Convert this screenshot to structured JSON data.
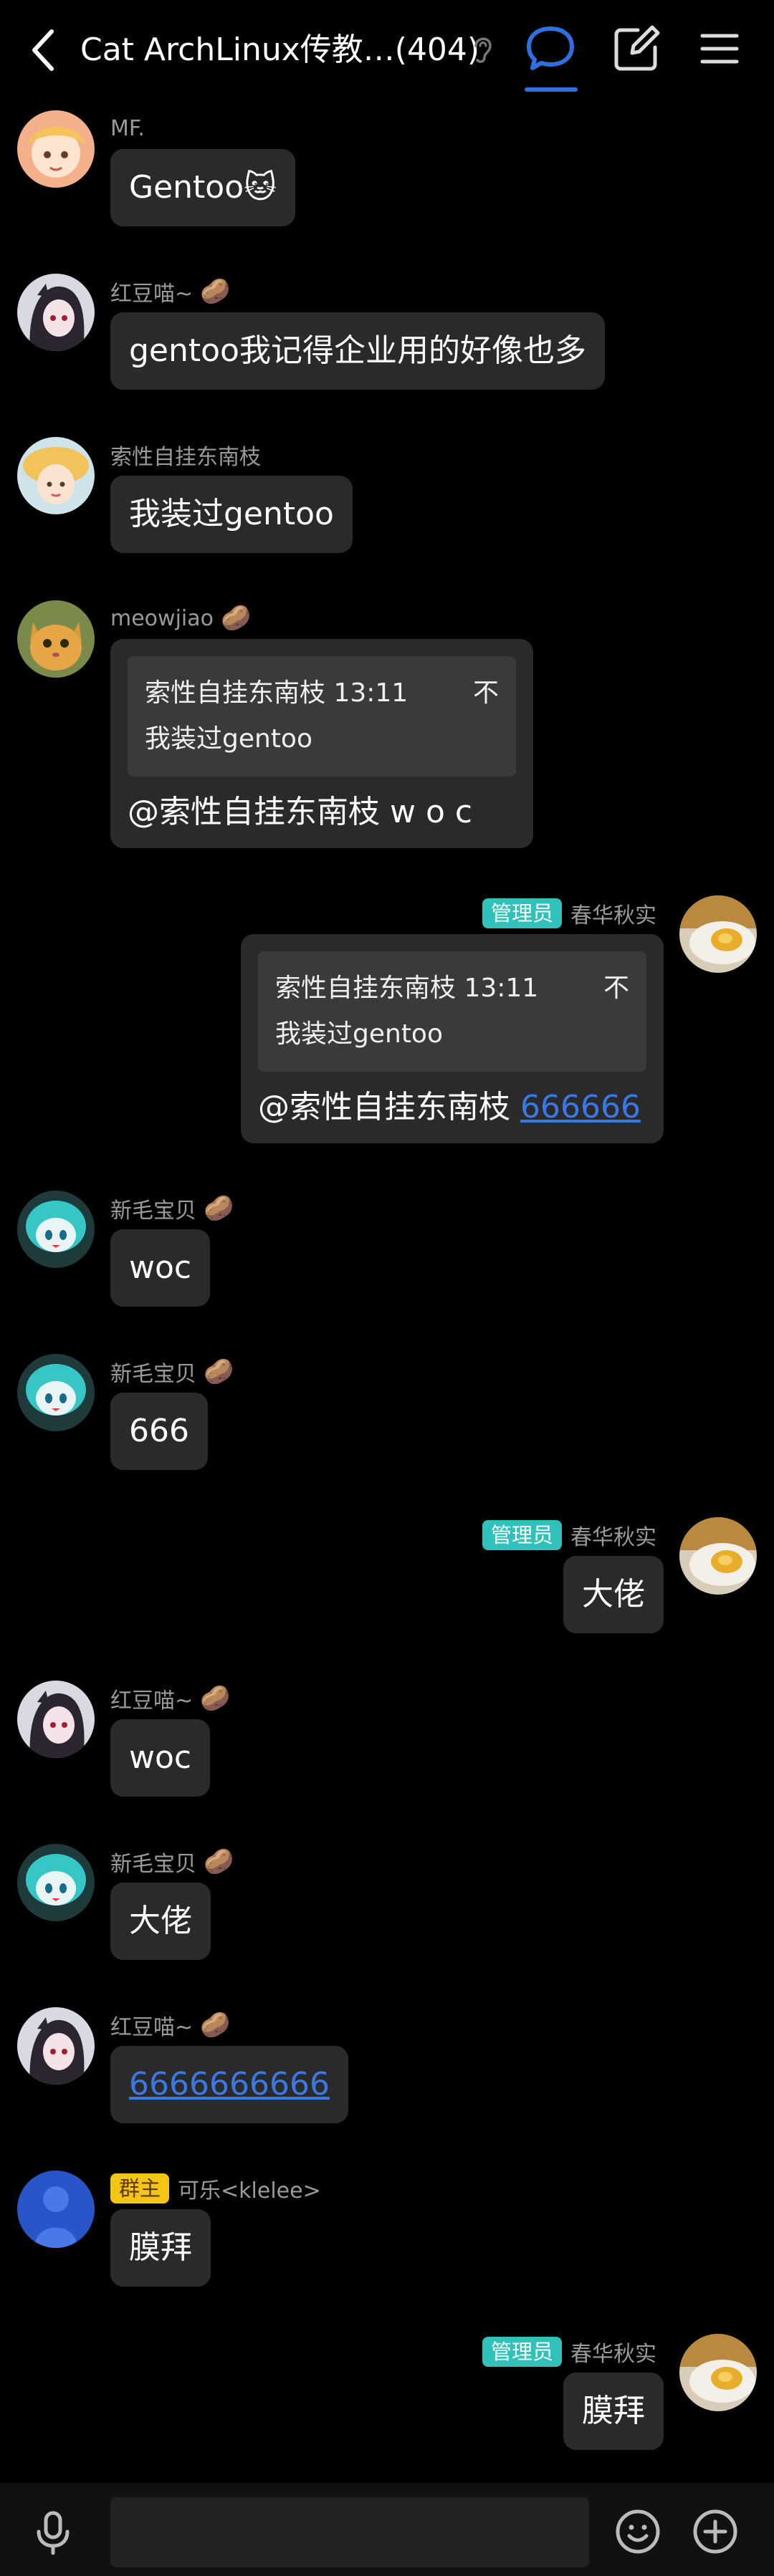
{
  "header": {
    "title": "Cat ArchLinux传教…(404)",
    "accent_color": "#2f6fe0",
    "icons": [
      "back-arrow-icon",
      "ear-icon",
      "chat-bubble-icon",
      "edit-icon",
      "menu-icon"
    ]
  },
  "messages": [
    {
      "side": "left",
      "sender": "MF.",
      "avatar": "avatar-anime-blonde",
      "text": "Gentoo🐱",
      "has_badge": false
    },
    {
      "side": "left",
      "sender": "红豆喵~",
      "avatar": "avatar-anime-dark-hair",
      "text": "gentoo我记得企业用的好像也多",
      "has_badge": true
    },
    {
      "side": "left",
      "sender": "索性自挂东南枝",
      "avatar": "avatar-girl-yellow-hat",
      "text": "我装过gentoo",
      "has_badge": false
    },
    {
      "side": "left",
      "sender": "meowjiao",
      "avatar": "avatar-cat",
      "has_badge": true,
      "quote": {
        "author": "索性自挂东南枝 13:11",
        "text": "我装过gentoo"
      },
      "text": "@索性自挂东南枝 w o c"
    },
    {
      "side": "right",
      "sender": "春华秋实",
      "role": "管理员",
      "avatar": "avatar-egg-plate",
      "quote": {
        "author": "索性自挂东南枝 13:11",
        "text": "我装过gentoo"
      },
      "text": "@索性自挂东南枝 ",
      "link": "666666"
    },
    {
      "side": "left",
      "sender": "新毛宝贝",
      "avatar": "avatar-miku",
      "text": "woc",
      "has_badge": true
    },
    {
      "side": "left",
      "sender": "新毛宝贝",
      "avatar": "avatar-miku",
      "text": "666",
      "has_badge": true
    },
    {
      "side": "right",
      "sender": "春华秋实",
      "role": "管理员",
      "avatar": "avatar-egg-plate",
      "text": "大佬"
    },
    {
      "side": "left",
      "sender": "红豆喵~",
      "avatar": "avatar-anime-dark-hair",
      "text": "woc",
      "has_badge": true
    },
    {
      "side": "left",
      "sender": "新毛宝贝",
      "avatar": "avatar-miku",
      "text": "大佬",
      "has_badge": true
    },
    {
      "side": "left",
      "sender": "红豆喵~",
      "avatar": "avatar-anime-dark-hair",
      "link": "6666666666",
      "has_badge": true
    },
    {
      "side": "left",
      "sender": "可乐<klelee>",
      "role": "群主",
      "avatar": "avatar-blue-figure",
      "text": "膜拜"
    },
    {
      "side": "right",
      "sender": "春华秋实",
      "role": "管理员",
      "avatar": "avatar-egg-plate",
      "text": "膜拜"
    }
  ],
  "bottom_bar": {
    "icons": [
      "microphone-icon",
      "emoji-icon",
      "plus-icon"
    ],
    "input_value": ""
  },
  "quote_arrow": "不",
  "badge_emoji": "🥔"
}
